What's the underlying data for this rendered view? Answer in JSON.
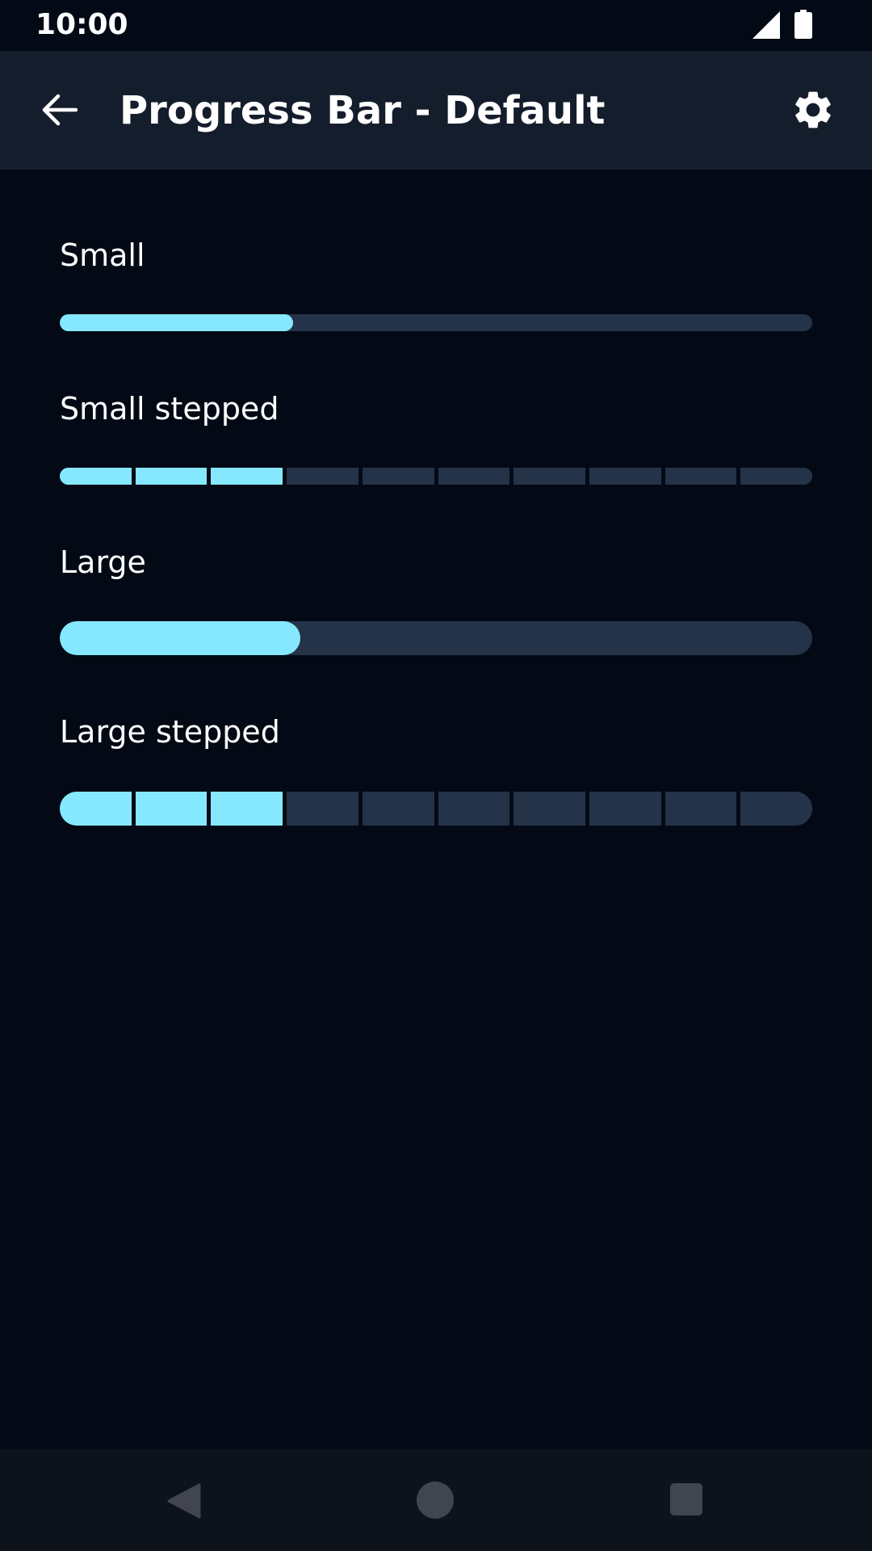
{
  "status_bar": {
    "time": "10:00",
    "signal_icon": "signal-icon",
    "battery_icon": "battery-icon"
  },
  "app_bar": {
    "title": "Progress Bar - Default",
    "back_icon": "arrow-back-icon",
    "settings_icon": "gear-icon"
  },
  "progress_bars": [
    {
      "label": "Small",
      "variant": "small",
      "progress": 0.31
    },
    {
      "label": "Small stepped",
      "variant": "small-stepped",
      "steps_total": 10,
      "steps_completed": 3
    },
    {
      "label": "Large",
      "variant": "large",
      "progress": 0.32
    },
    {
      "label": "Large stepped",
      "variant": "large-stepped",
      "steps_total": 10,
      "steps_completed": 3
    }
  ],
  "nav_bar": {
    "back_icon": "triangle-back-icon",
    "home_icon": "circle-home-icon",
    "recents_icon": "square-recents-icon"
  },
  "colors": {
    "background": "#030a15",
    "app_bar": "#141d2c",
    "track": "#253348",
    "fill": "#86e8ff",
    "nav_bar": "#0d121b"
  }
}
